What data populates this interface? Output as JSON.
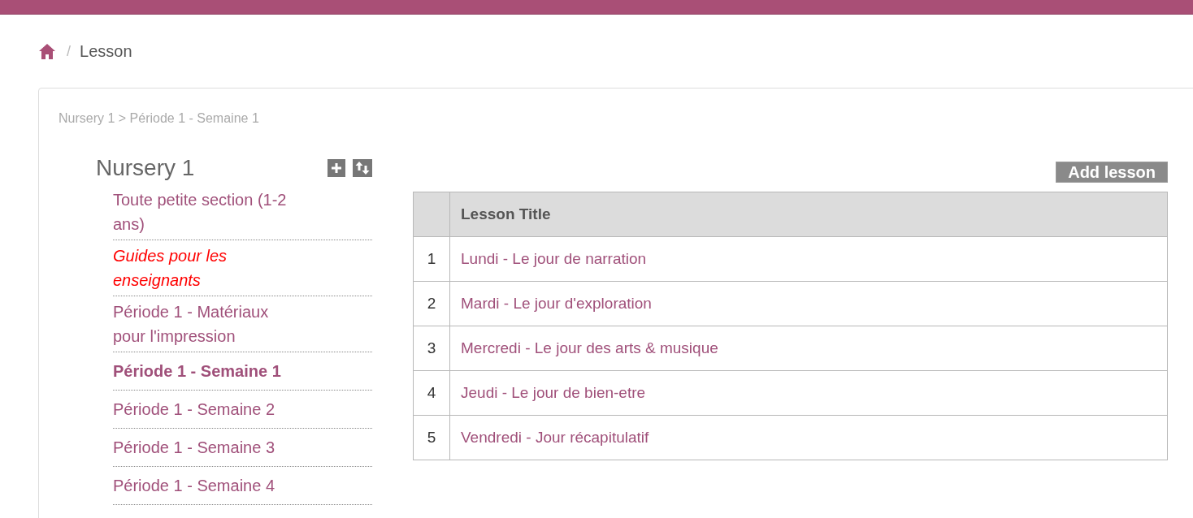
{
  "breadcrumb": {
    "separator": "/",
    "current": "Lesson"
  },
  "panel": {
    "path": "Nursery 1 > Période 1 - Semaine 1"
  },
  "sidebar": {
    "title": "Nursery 1",
    "items": [
      {
        "label": "Toute petite section (1-2 ans)",
        "kind": "link",
        "selected": false
      },
      {
        "label": "Guides pour les enseignants",
        "kind": "guide",
        "selected": false
      },
      {
        "label": "Période 1 - Matériaux pour l'impression",
        "kind": "link",
        "selected": false
      },
      {
        "label": "Période 1 - Semaine 1",
        "kind": "link",
        "selected": true
      },
      {
        "label": "Période 1 - Semaine 2",
        "kind": "link",
        "selected": false
      },
      {
        "label": "Période 1 - Semaine 3",
        "kind": "link",
        "selected": false
      },
      {
        "label": "Période 1 - Semaine 4",
        "kind": "link",
        "selected": false
      }
    ]
  },
  "add_button": {
    "label": "Add lesson"
  },
  "table": {
    "header": "Lesson Title",
    "rows": [
      {
        "number": "1",
        "title": "Lundi - Le jour de narration"
      },
      {
        "number": "2",
        "title": "Mardi - Le jour d'exploration"
      },
      {
        "number": "3",
        "title": "Mercredi - Le jour des arts & musique"
      },
      {
        "number": "4",
        "title": "Jeudi - Le jour de bien-etre"
      },
      {
        "number": "5",
        "title": "Vendredi - Jour récapitulatif"
      }
    ]
  }
}
